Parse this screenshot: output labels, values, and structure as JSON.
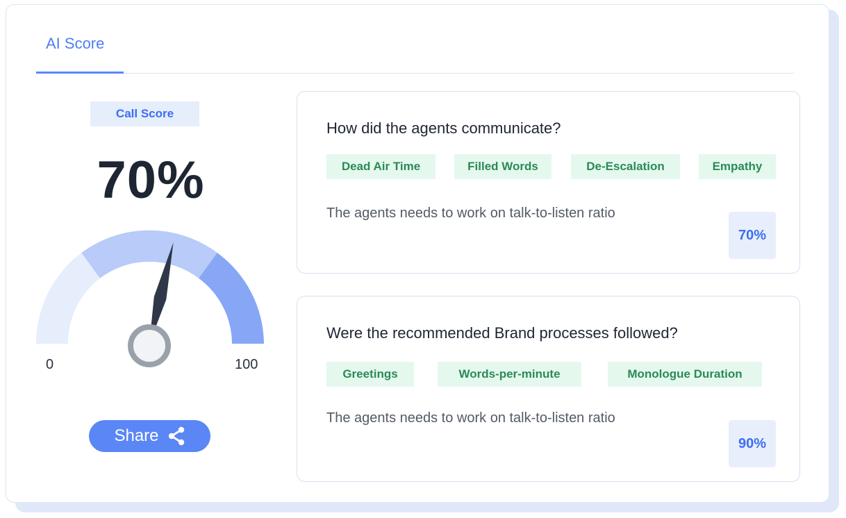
{
  "tabs": [
    {
      "label": "AI Score",
      "active": true
    }
  ],
  "call_score": {
    "badge": "Call Score",
    "value": "70%",
    "gauge": {
      "min_label": "0",
      "max_label": "100",
      "value": 70
    }
  },
  "share": {
    "label": "Share",
    "icon": "share-icon"
  },
  "panels": [
    {
      "title": "How did the agents communicate?",
      "tags": [
        "Dead Air Time",
        "Filled Words",
        "De-Escalation",
        "Empathy"
      ],
      "note": "The agents needs to work on talk-to-listen ratio",
      "score": "70%"
    },
    {
      "title": "Were the recommended Brand processes followed?",
      "tags": [
        "Greetings",
        "Words-per-minute",
        "Monologue Duration"
      ],
      "note": "The agents needs to work on talk-to-listen ratio",
      "score": "90%"
    }
  ],
  "colors": {
    "accent": "#5b86f6",
    "tag_bg": "#e5f8ee",
    "tag_text": "#2b8a57",
    "gauge_light": "#e6edfb",
    "gauge_mid": "#b8cbf9",
    "gauge_dark": "#87a7f6",
    "needle": "#2e3848"
  }
}
